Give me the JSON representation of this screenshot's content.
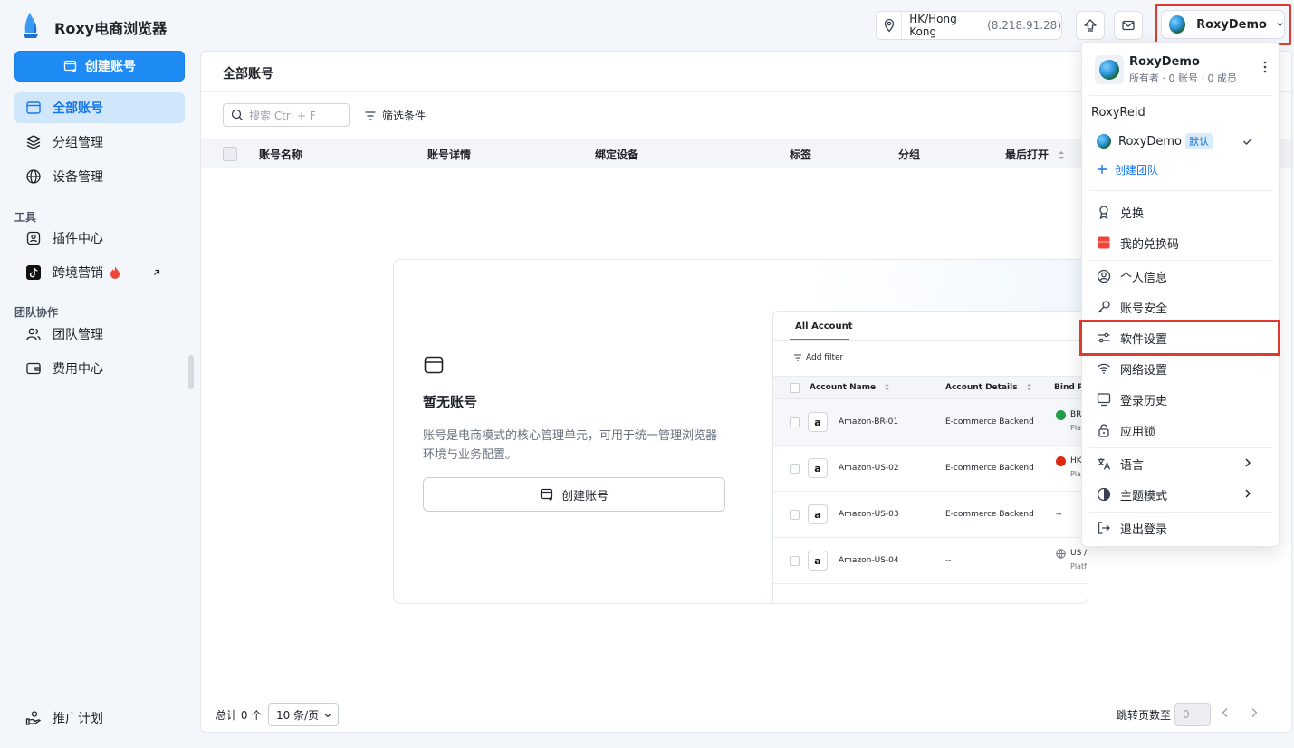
{
  "app": {
    "title": "Roxy电商浏览器"
  },
  "header": {
    "location": "HK/Hong Kong",
    "ip": "(8.218.91.28)",
    "user_name": "RoxyDemo"
  },
  "sidebar": {
    "create_label": "创建账号",
    "items": [
      {
        "label": "全部账号"
      },
      {
        "label": "分组管理"
      },
      {
        "label": "设备管理"
      }
    ],
    "tools_title": "工具",
    "tools": [
      {
        "label": "插件中心"
      },
      {
        "label": "跨境营销"
      }
    ],
    "team_title": "团队协作",
    "team": [
      {
        "label": "团队管理"
      },
      {
        "label": "费用中心"
      }
    ],
    "promo_label": "推广计划"
  },
  "main": {
    "title": "全部账号",
    "search_placeholder": "搜索 Ctrl + F",
    "filter_label": "筛选条件",
    "columns": [
      "账号名称",
      "账号详情",
      "绑定设备",
      "标签",
      "分组",
      "最后打开"
    ],
    "empty": {
      "title": "暂无账号",
      "desc": "账号是电商模式的核心管理单元，可用于统一管理浏览器环境与业务配置。",
      "button": "创建账号"
    },
    "preview": {
      "tab": "All Account",
      "filter": "Add filter",
      "columns": [
        "Account Name",
        "Account Details",
        "Bind Pr"
      ],
      "rows": [
        {
          "name": "Amazon-BR-01",
          "details": "E-commerce Backend",
          "bind": "BR",
          "bind_sub": "Pla"
        },
        {
          "name": "Amazon-US-02",
          "details": "E-commerce Backend",
          "bind": "HK",
          "bind_sub": "Pla"
        },
        {
          "name": "Amazon-US-03",
          "details": "E-commerce Backend",
          "bind": "--",
          "bind_sub": ""
        },
        {
          "name": "Amazon-US-04",
          "details": "--",
          "bind": "US /",
          "bind_sub": "Platf"
        }
      ]
    },
    "footer": {
      "total": "总计 0 个",
      "page_size": "10 条/页",
      "jump_label": "跳转页数至",
      "jump_placeholder": "0"
    }
  },
  "dropdown": {
    "account_name": "RoxyDemo",
    "account_meta": "所有者 · 0 账号 · 0 成员",
    "owner_section": "RoxyReid",
    "team_name": "RoxyDemo",
    "default_badge": "默认",
    "create_team": "创建团队",
    "items": [
      {
        "label": "兑换",
        "icon": "award-icon"
      },
      {
        "label": "我的兑换码",
        "icon": "coupon-icon"
      },
      {
        "label": "个人信息",
        "icon": "user-circle-icon"
      },
      {
        "label": "账号安全",
        "icon": "key-icon"
      },
      {
        "label": "软件设置",
        "icon": "sliders-icon"
      },
      {
        "label": "网络设置",
        "icon": "wifi-icon"
      },
      {
        "label": "登录历史",
        "icon": "monitor-icon"
      },
      {
        "label": "应用锁",
        "icon": "lock-icon"
      },
      {
        "label": "语言",
        "icon": "translate-icon"
      },
      {
        "label": "主题模式",
        "icon": "theme-icon"
      },
      {
        "label": "退出登录",
        "icon": "logout-icon"
      }
    ]
  },
  "colors": {
    "accent": "#1f8cf5",
    "highlight": "#e03a2e",
    "active_bg": "#cfe6fb"
  }
}
